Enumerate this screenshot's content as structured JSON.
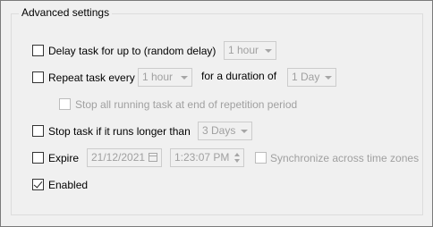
{
  "group": {
    "title": "Advanced settings"
  },
  "delay": {
    "label": "Delay task for up to (random delay)",
    "value": "1 hour",
    "checked": false
  },
  "repeat": {
    "label": "Repeat task every",
    "value": "1 hour",
    "duration_label": "for a duration of",
    "duration_value": "1 Day",
    "checked": false
  },
  "stop_all": {
    "label": "Stop all running task at end of repetition period",
    "checked": false,
    "enabled": false
  },
  "stop_long": {
    "label": "Stop task if it runs longer than",
    "value": "3 Days",
    "checked": false
  },
  "expire": {
    "label": "Expire",
    "date": "21/12/2021",
    "time": "1:23:07 PM",
    "checked": false
  },
  "sync": {
    "label": "Synchronize across time zones",
    "checked": false,
    "enabled": false
  },
  "enabled": {
    "label": "Enabled",
    "checked": true
  },
  "icons": {
    "calendar": "calendar-icon",
    "dropdown": "chevron-down-icon",
    "spinner": "spin-updown-icon"
  },
  "colors": {
    "background": "#f0f0f0",
    "disabled_text": "#a0a0a0",
    "group_border": "#dcdcdc"
  }
}
